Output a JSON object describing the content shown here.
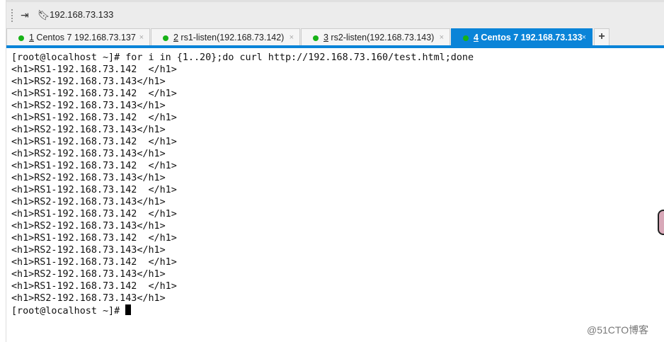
{
  "toolbar": {
    "host": "192.168.73.133"
  },
  "tabs": [
    {
      "num": "1",
      "label": " Centos 7 192.168.73.137",
      "active": false
    },
    {
      "num": "2",
      "label": " rs1-listen(192.168.73.142)",
      "active": false
    },
    {
      "num": "3",
      "label": " rs2-listen(192.168.73.143)",
      "active": false
    },
    {
      "num": "4",
      "label": " Centos 7 192.168.73.133",
      "active": true
    }
  ],
  "new_tab": "+",
  "close": "×",
  "terminal": {
    "command": "[root@localhost ~]# for i in {1..20};do curl http://192.168.73.160/test.html;done",
    "output": [
      "<h1>RS1-192.168.73.142  </h1>",
      "<h1>RS2-192.168.73.143</h1>",
      "<h1>RS1-192.168.73.142  </h1>",
      "<h1>RS2-192.168.73.143</h1>",
      "<h1>RS1-192.168.73.142  </h1>",
      "<h1>RS2-192.168.73.143</h1>",
      "<h1>RS1-192.168.73.142  </h1>",
      "<h1>RS2-192.168.73.143</h1>",
      "<h1>RS1-192.168.73.142  </h1>",
      "<h1>RS2-192.168.73.143</h1>",
      "<h1>RS1-192.168.73.142  </h1>",
      "<h1>RS2-192.168.73.143</h1>",
      "<h1>RS1-192.168.73.142  </h1>",
      "<h1>RS2-192.168.73.143</h1>",
      "<h1>RS1-192.168.73.142  </h1>",
      "<h1>RS2-192.168.73.143</h1>",
      "<h1>RS1-192.168.73.142  </h1>",
      "<h1>RS2-192.168.73.143</h1>",
      "<h1>RS1-192.168.73.142  </h1>",
      "<h1>RS2-192.168.73.143</h1>"
    ],
    "prompt": "[root@localhost ~]# "
  },
  "watermark": "@51CTO博客"
}
